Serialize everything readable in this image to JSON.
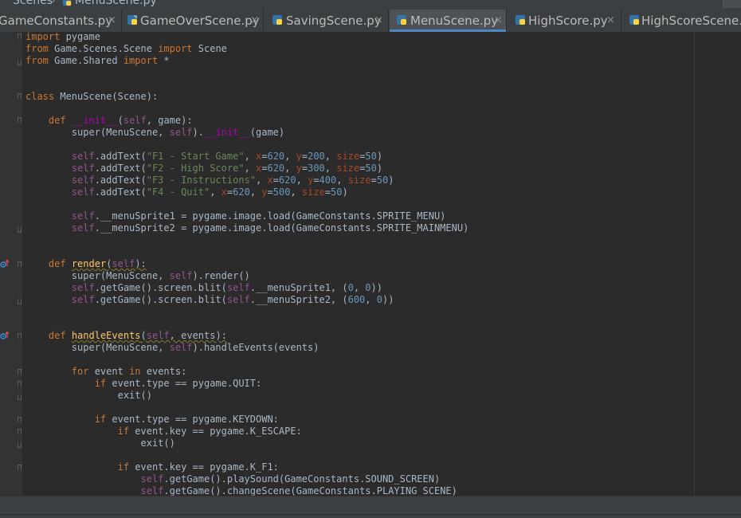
{
  "breadcrumb": {
    "items": [
      "Scenes",
      "MenuScene.py"
    ],
    "separator": "›"
  },
  "tabs": [
    {
      "label": "GameConstants.py",
      "active": false
    },
    {
      "label": "GameOverScene.py",
      "active": false
    },
    {
      "label": "SavingScene.py",
      "active": false
    },
    {
      "label": "MenuScene.py",
      "active": true
    },
    {
      "label": "HighScore.py",
      "active": false
    },
    {
      "label": "HighScoreScene.py",
      "active": false
    }
  ],
  "tab_close_glyph": "×",
  "colors": {
    "background": "#2b2b2b",
    "gutter": "#313335",
    "tabbar": "#3c3f41",
    "active_tab": "#4e5254",
    "active_tab_underline": "#4a88c7",
    "keyword": "#cc7832",
    "self": "#94558d",
    "string": "#6a8759",
    "number": "#6897bb",
    "param": "#aa4926",
    "magic": "#b200b2",
    "function": "#ffc66d",
    "text": "#a9b7c6"
  },
  "code": {
    "lines": [
      [
        [
          "kw",
          "import"
        ],
        [
          "plain",
          " pygame"
        ]
      ],
      [
        [
          "kw",
          "from"
        ],
        [
          "plain",
          " Game.Scenes.Scene "
        ],
        [
          "kw",
          "import"
        ],
        [
          "plain",
          " Scene"
        ]
      ],
      [
        [
          "kw",
          "from"
        ],
        [
          "plain",
          " Game.Shared "
        ],
        [
          "kw",
          "import"
        ],
        [
          "plain",
          " *"
        ]
      ],
      [],
      [],
      [
        [
          "kw",
          "class"
        ],
        [
          "plain",
          " MenuScene(Scene):"
        ]
      ],
      [],
      [
        [
          "plain",
          "    "
        ],
        [
          "kw",
          "def"
        ],
        [
          "plain",
          " "
        ],
        [
          "magic",
          "__init__"
        ],
        [
          "plain",
          "("
        ],
        [
          "self",
          "self"
        ],
        [
          "plain",
          ", game):"
        ]
      ],
      [
        [
          "plain",
          "        super(MenuScene, "
        ],
        [
          "self",
          "self"
        ],
        [
          "plain",
          ")."
        ],
        [
          "magic",
          "__init__"
        ],
        [
          "plain",
          "(game)"
        ]
      ],
      [],
      [
        [
          "plain",
          "        "
        ],
        [
          "self",
          "self"
        ],
        [
          "plain",
          ".addText("
        ],
        [
          "str",
          "\"F1 - Start Game\""
        ],
        [
          "plain",
          ", "
        ],
        [
          "param",
          "x"
        ],
        [
          "plain",
          "="
        ],
        [
          "num",
          "620"
        ],
        [
          "plain",
          ", "
        ],
        [
          "param",
          "y"
        ],
        [
          "plain",
          "="
        ],
        [
          "num",
          "200"
        ],
        [
          "plain",
          ", "
        ],
        [
          "param",
          "size"
        ],
        [
          "plain",
          "="
        ],
        [
          "num",
          "50"
        ],
        [
          "plain",
          ")"
        ]
      ],
      [
        [
          "plain",
          "        "
        ],
        [
          "self",
          "self"
        ],
        [
          "plain",
          ".addText("
        ],
        [
          "str",
          "\"F2 - High Score\""
        ],
        [
          "plain",
          ", "
        ],
        [
          "param",
          "x"
        ],
        [
          "plain",
          "="
        ],
        [
          "num",
          "620"
        ],
        [
          "plain",
          ", "
        ],
        [
          "param",
          "y"
        ],
        [
          "plain",
          "="
        ],
        [
          "num",
          "300"
        ],
        [
          "plain",
          ", "
        ],
        [
          "param",
          "size"
        ],
        [
          "plain",
          "="
        ],
        [
          "num",
          "50"
        ],
        [
          "plain",
          ")"
        ]
      ],
      [
        [
          "plain",
          "        "
        ],
        [
          "self",
          "self"
        ],
        [
          "plain",
          ".addText("
        ],
        [
          "str",
          "\"F3 - Instructions\""
        ],
        [
          "plain",
          ", "
        ],
        [
          "param",
          "x"
        ],
        [
          "plain",
          "="
        ],
        [
          "num",
          "620"
        ],
        [
          "plain",
          ", "
        ],
        [
          "param",
          "y"
        ],
        [
          "plain",
          "="
        ],
        [
          "num",
          "400"
        ],
        [
          "plain",
          ", "
        ],
        [
          "param",
          "size"
        ],
        [
          "plain",
          "="
        ],
        [
          "num",
          "50"
        ],
        [
          "plain",
          ")"
        ]
      ],
      [
        [
          "plain",
          "        "
        ],
        [
          "self",
          "self"
        ],
        [
          "plain",
          ".addText("
        ],
        [
          "str",
          "\"F4 - Quit\""
        ],
        [
          "plain",
          ", "
        ],
        [
          "param",
          "x"
        ],
        [
          "plain",
          "="
        ],
        [
          "num",
          "620"
        ],
        [
          "plain",
          ", "
        ],
        [
          "param",
          "y"
        ],
        [
          "plain",
          "="
        ],
        [
          "num",
          "500"
        ],
        [
          "plain",
          ", "
        ],
        [
          "param",
          "size"
        ],
        [
          "plain",
          "="
        ],
        [
          "num",
          "50"
        ],
        [
          "plain",
          ")"
        ]
      ],
      [],
      [
        [
          "plain",
          "        "
        ],
        [
          "self",
          "self"
        ],
        [
          "plain",
          ".__menuSprite1 = pygame.image.load(GameConstants.SPRITE_MENU)"
        ]
      ],
      [
        [
          "plain",
          "        "
        ],
        [
          "self",
          "self"
        ],
        [
          "plain",
          ".__menuSprite2 = pygame.image.load(GameConstants.SPRITE_MAINMENU)"
        ]
      ],
      [],
      [],
      [
        [
          "plain",
          "    "
        ],
        [
          "kw",
          "def"
        ],
        [
          "plain",
          " "
        ],
        [
          "fnsq",
          "render"
        ],
        [
          "plainsq",
          "("
        ],
        [
          "selfsq",
          "self"
        ],
        [
          "plainsq",
          "):"
        ]
      ],
      [
        [
          "plain",
          "        super(MenuScene, "
        ],
        [
          "self",
          "self"
        ],
        [
          "plain",
          ").render()"
        ]
      ],
      [
        [
          "plain",
          "        "
        ],
        [
          "self",
          "self"
        ],
        [
          "plain",
          ".getGame().screen.blit("
        ],
        [
          "self",
          "self"
        ],
        [
          "plain",
          ".__menuSprite1, ("
        ],
        [
          "num",
          "0"
        ],
        [
          "plain",
          ", "
        ],
        [
          "num",
          "0"
        ],
        [
          "plain",
          "))"
        ]
      ],
      [
        [
          "plain",
          "        "
        ],
        [
          "self",
          "self"
        ],
        [
          "plain",
          ".getGame().screen.blit("
        ],
        [
          "self",
          "self"
        ],
        [
          "plain",
          ".__menuSprite2, ("
        ],
        [
          "num",
          "600"
        ],
        [
          "plain",
          ", "
        ],
        [
          "num",
          "0"
        ],
        [
          "plain",
          "))"
        ]
      ],
      [],
      [],
      [
        [
          "plain",
          "    "
        ],
        [
          "kw",
          "def"
        ],
        [
          "plain",
          " "
        ],
        [
          "fnsq",
          "handleEvents"
        ],
        [
          "plainsq",
          "("
        ],
        [
          "selfsq",
          "self"
        ],
        [
          "plainsq",
          ", events):"
        ]
      ],
      [
        [
          "plain",
          "        super(MenuScene, "
        ],
        [
          "self",
          "self"
        ],
        [
          "plain",
          ").handleEvents(events)"
        ]
      ],
      [],
      [
        [
          "plain",
          "        "
        ],
        [
          "kw",
          "for"
        ],
        [
          "plain",
          " event "
        ],
        [
          "kw",
          "in"
        ],
        [
          "plain",
          " events:"
        ]
      ],
      [
        [
          "plain",
          "            "
        ],
        [
          "kw",
          "if"
        ],
        [
          "plain",
          " event.type == pygame.QUIT:"
        ]
      ],
      [
        [
          "plain",
          "                exit()"
        ]
      ],
      [],
      [
        [
          "plain",
          "            "
        ],
        [
          "kw",
          "if"
        ],
        [
          "plain",
          " event.type == pygame.KEYDOWN:"
        ]
      ],
      [
        [
          "plain",
          "                "
        ],
        [
          "kw",
          "if"
        ],
        [
          "plain",
          " event.key == pygame.K_ESCAPE:"
        ]
      ],
      [
        [
          "plain",
          "                    exit()"
        ]
      ],
      [],
      [
        [
          "plain",
          "                "
        ],
        [
          "kw",
          "if"
        ],
        [
          "plain",
          " event.key == pygame.K_F1:"
        ]
      ],
      [
        [
          "plain",
          "                    "
        ],
        [
          "self",
          "self"
        ],
        [
          "plain",
          ".getGame().playSound(GameConstants.SOUND_SCREEN)"
        ]
      ],
      [
        [
          "plain",
          "                    "
        ],
        [
          "self",
          "self"
        ],
        [
          "plain",
          ".getGame().changeScene(GameConstants.PLAYING_SCENE)"
        ]
      ]
    ]
  }
}
